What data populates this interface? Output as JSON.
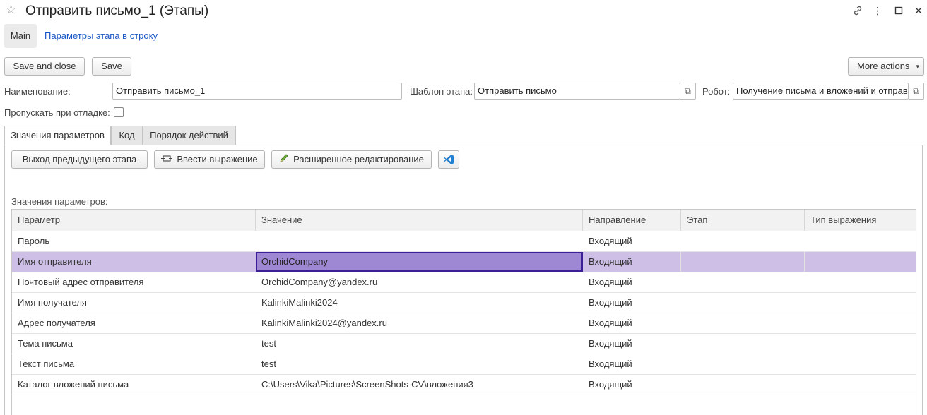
{
  "window": {
    "title": "Отправить письмо_1 (Этапы)"
  },
  "nav": {
    "main_tab": "Main",
    "link": "Параметры этапа в строку"
  },
  "toolbar": {
    "save_and_close": "Save and close",
    "save": "Save",
    "more_actions": "More actions"
  },
  "form": {
    "name_label": "Наименование:",
    "name_value": "Отправить письмо_1",
    "template_label": "Шаблон этапа:",
    "template_value": "Отправить письмо",
    "robot_label": "Робот:",
    "robot_value": "Получение письма и вложений и отправ",
    "skip_label": "Пропускать при отладке:",
    "skip_checked": false
  },
  "tabs": [
    {
      "label": "Значения параметров",
      "active": true
    },
    {
      "label": "Код",
      "active": false
    },
    {
      "label": "Порядок действий",
      "active": false
    }
  ],
  "panel_buttons": {
    "prev_output": "Выход предыдущего этапа",
    "enter_expression": "Ввести выражение",
    "advanced_edit": "Расширенное редактирование"
  },
  "grid": {
    "caption": "Значения параметров:",
    "columns": [
      "Параметр",
      "Значение",
      "Направление",
      "Этап",
      "Тип выражения"
    ],
    "rows": [
      {
        "param": "Пароль",
        "value": "",
        "direction": "Входящий",
        "stage": "",
        "expr_type": ""
      },
      {
        "param": "Имя отправителя",
        "value": "OrchidCompany",
        "direction": "Входящий",
        "stage": "",
        "expr_type": "",
        "selected": true
      },
      {
        "param": "Почтовый адрес отправителя",
        "value": "OrchidCompany@yandex.ru",
        "direction": "Входящий",
        "stage": "",
        "expr_type": ""
      },
      {
        "param": "Имя получателя",
        "value": "KalinkiMalinki2024",
        "direction": "Входящий",
        "stage": "",
        "expr_type": ""
      },
      {
        "param": "Адрес получателя",
        "value": "KalinkiMalinki2024@yandex.ru",
        "direction": "Входящий",
        "stage": "",
        "expr_type": ""
      },
      {
        "param": "Тема письма",
        "value": "test",
        "direction": "Входящий",
        "stage": "",
        "expr_type": ""
      },
      {
        "param": "Текст письма",
        "value": "test",
        "direction": "Входящий",
        "stage": "",
        "expr_type": ""
      },
      {
        "param": "Каталог вложений письма",
        "value": "C:\\Users\\Vika\\Pictures\\ScreenShots-CV\\вложения3",
        "direction": "Входящий",
        "stage": "",
        "expr_type": ""
      }
    ]
  },
  "colors": {
    "link": "#1a57c4",
    "selected_row": "#cdbfe5",
    "active_cell": "#9f88d3",
    "active_cell_border": "#3c1f96"
  },
  "icons": {
    "favorite": "star-icon",
    "link": "link-icon",
    "menu": "kebab-menu-icon",
    "maximize": "maximize-icon",
    "close": "close-icon",
    "open_field": "open-form-icon",
    "expression": "expression-icon",
    "edit": "pencil-icon",
    "vscode": "vscode-icon",
    "dropdown": "chevron-down-icon"
  }
}
